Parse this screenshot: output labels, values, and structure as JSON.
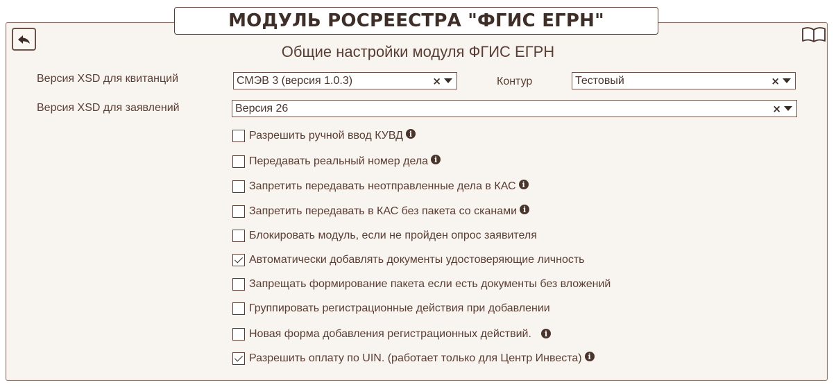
{
  "header": {
    "title": "МОДУЛЬ РОСРЕЕСТРА \"ФГИС ЕГРН\""
  },
  "page": {
    "subtitle": "Общие настройки модуля ФГИС ЕГРН"
  },
  "icons": {
    "back": "back-arrow-icon",
    "help": "open-book-icon",
    "info": "info-icon"
  },
  "colors": {
    "text": "#5a3e33",
    "border": "#6c5248",
    "panel_bg": "#f8f4f0"
  },
  "form": {
    "xsd_receipts": {
      "label": "Версия XSD для квитанций",
      "value": "СМЭВ 3 (версия 1.0.3)"
    },
    "contour": {
      "label": "Контур",
      "value": "Тестовый"
    },
    "xsd_applications": {
      "label": "Версия XSD для заявлений",
      "value": "Версия 26"
    },
    "clear_symbol": "×",
    "checkboxes": [
      {
        "label": "Разрешить ручной ввод КУВД",
        "checked": false,
        "info": true
      },
      {
        "label": "Передавать реальный номер дела",
        "checked": false,
        "info": true
      },
      {
        "label": "Запретить передавать неотправленные дела в КАС",
        "checked": false,
        "info": true
      },
      {
        "label": "Запретить передавать в КАС без пакета со сканами",
        "checked": false,
        "info": true
      },
      {
        "label": "Блокировать модуль, если не пройден опрос заявителя",
        "checked": false,
        "info": false
      },
      {
        "label": "Автоматически добавлять документы удостоверяющие личность",
        "checked": true,
        "info": false
      },
      {
        "label": "Запрещать формирование пакета если есть документы без вложений",
        "checked": false,
        "info": false
      },
      {
        "label": "Группировать регистрационные действия при добавлении",
        "checked": false,
        "info": false
      },
      {
        "label": "Новая форма добавления регистрационных действий.",
        "checked": false,
        "info": true
      },
      {
        "label": "Разрешить оплату по UIN. (работает только для Центр Инвеста)",
        "checked": true,
        "info": true
      }
    ]
  }
}
